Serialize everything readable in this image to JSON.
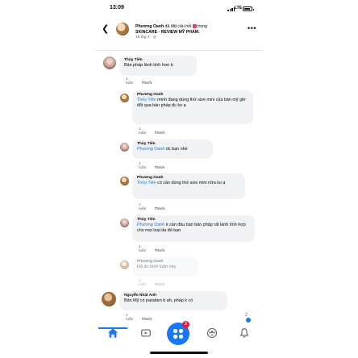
{
  "status_bar": {
    "time": "13:09",
    "network": "LTE"
  },
  "header": {
    "back_icon": "chevron-left-icon",
    "author": "Phương Oanh",
    "action": " đã đặt câu hỏi ",
    "in_word": " trong",
    "group": "SKINCARE - REVIEW MỸ PHẨM.",
    "date": "15 thg 3 · ",
    "more_icon": "ellipsis-icon"
  },
  "comments": [
    {
      "name": "Thủy Tiên",
      "text": "Bản pháp lành tính hơn b",
      "time": "1 tuần",
      "reply": "Thích"
    },
    {
      "name": "Phương Oanh",
      "mention": "Thủy Tiên",
      "text": " mình đang dùng thử size mini của bản mỹ giờ đổi qua bản pháp đc ko ạ",
      "time": "1 tuần",
      "reply": "Thích"
    },
    {
      "name": "Thủy Tiên",
      "mention": "Phương Oanh",
      "text": " dc bạn nhé",
      "time": "1 tuần",
      "reply": "Thích"
    },
    {
      "name": "Phương Oanh",
      "mention": "Thủy Tiên",
      "text": " có cần dùng thử size mini nữa ko ạ",
      "time": "1 tuần",
      "reply": "Thích"
    },
    {
      "name": "Thủy Tiên",
      "mention": "Phương Oanh",
      "text": " k cần đâu bạn bản pháp rất lành tính hợp cho mọi loại da đó bạn",
      "time": "1 tuần",
      "reply": "Thích"
    },
    {
      "name": "Phương Oanh",
      "text": "Đã ẩn bình luận này.",
      "time": "1 tuần",
      "reply": "Thích"
    },
    {
      "name": "Nguyễn Nhật Anh",
      "text": "Bản Mỹ có paraben b ah, pháp k có",
      "time": "1 tuần",
      "reply": "Thích",
      "reactions": "2"
    }
  ],
  "nav": {
    "items": [
      "home-icon",
      "video-icon",
      "groups-icon",
      "bell-icon"
    ],
    "fab_badge": "2",
    "accent": "#1877f2"
  }
}
